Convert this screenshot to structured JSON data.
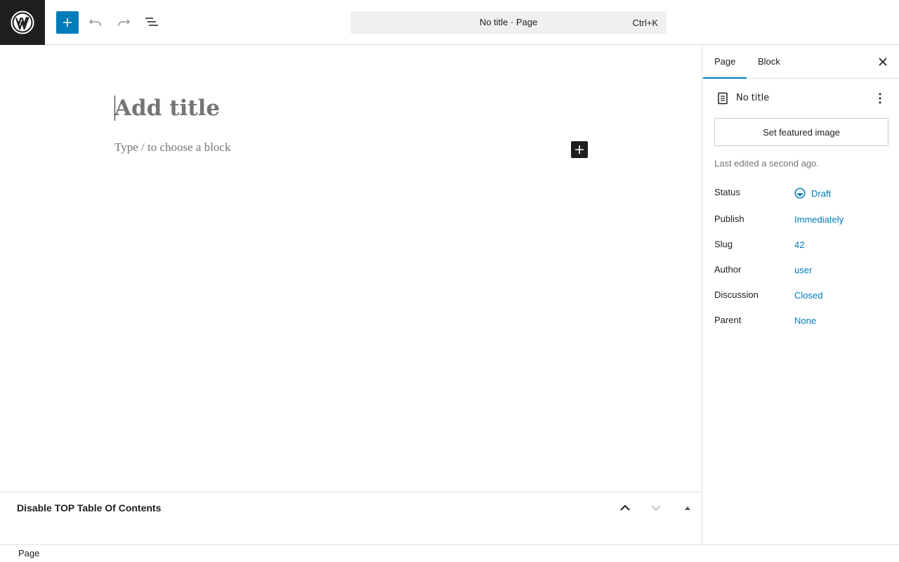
{
  "header": {
    "logo_icon": "wordpress-logo-icon",
    "inserter_icon": "plus-icon",
    "undo_icon": "undo-icon",
    "redo_icon": "redo-icon",
    "list_view_icon": "list-view-icon",
    "command_bar": {
      "title": "No title · Page",
      "shortcut": "Ctrl+K"
    },
    "colors": {
      "accent": "#007cba",
      "logo_bg": "#1e1e1e"
    }
  },
  "editor": {
    "title_placeholder": "Add title",
    "block_placeholder": "Type / to choose a block"
  },
  "metabox": {
    "title": "Disable TOP Table Of Contents"
  },
  "sidebar": {
    "tabs": [
      {
        "label": "Page",
        "active": true
      },
      {
        "label": "Block",
        "active": false
      }
    ],
    "document": {
      "title": "No title",
      "featured_image_label": "Set featured image",
      "last_edited": "Last edited a second ago."
    },
    "properties": [
      {
        "label": "Status",
        "value": "Draft"
      },
      {
        "label": "Publish",
        "value": "Immediately"
      },
      {
        "label": "Slug",
        "value": "42"
      },
      {
        "label": "Author",
        "value": "user"
      },
      {
        "label": "Discussion",
        "value": "Closed"
      },
      {
        "label": "Parent",
        "value": "None"
      }
    ]
  },
  "footer": {
    "breadcrumb": "Page"
  }
}
